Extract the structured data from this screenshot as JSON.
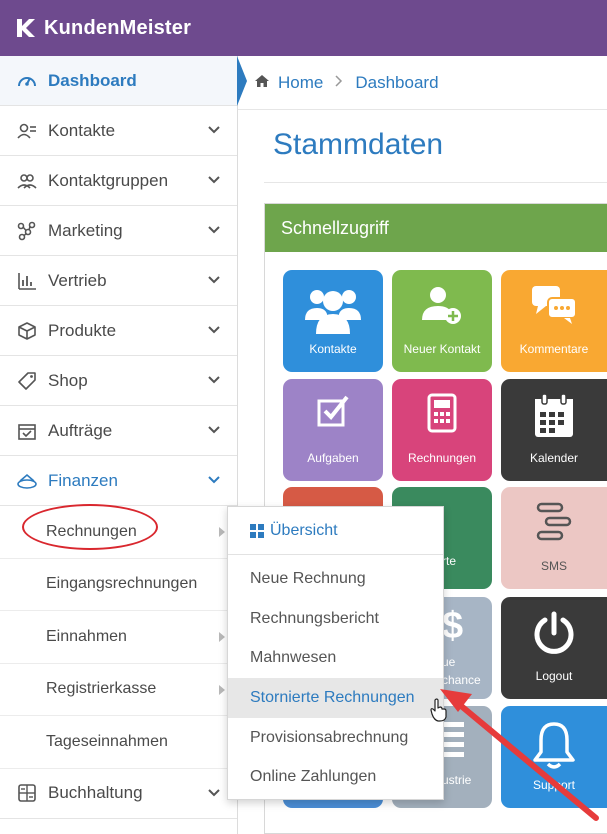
{
  "app": {
    "name": "KundenMeister"
  },
  "sidebar": {
    "items": [
      {
        "label": "Dashboard",
        "icon": "dashboard-icon"
      },
      {
        "label": "Kontakte",
        "icon": "contacts-icon"
      },
      {
        "label": "Kontaktgruppen",
        "icon": "contact-groups-icon"
      },
      {
        "label": "Marketing",
        "icon": "marketing-icon"
      },
      {
        "label": "Vertrieb",
        "icon": "sales-chart-icon"
      },
      {
        "label": "Produkte",
        "icon": "box-icon"
      },
      {
        "label": "Shop",
        "icon": "tag-icon"
      },
      {
        "label": "Aufträge",
        "icon": "orders-icon"
      },
      {
        "label": "Finanzen",
        "icon": "money-icon"
      }
    ],
    "finanzen_sub": [
      {
        "label": "Rechnungen"
      },
      {
        "label": "Eingangsrechnungen"
      },
      {
        "label": "Einnahmen"
      },
      {
        "label": "Registrierkasse"
      },
      {
        "label": "Tageseinnahmen"
      }
    ],
    "bottom": {
      "label": "Buchhaltung",
      "icon": "calculator-icon"
    }
  },
  "breadcrumb": {
    "home": "Home",
    "current": "Dashboard"
  },
  "page": {
    "title": "Stammdaten"
  },
  "panel": {
    "title": "Schnellzugriff"
  },
  "tiles": {
    "kontakte": "Kontakte",
    "neuer_kontakt": "Neuer Kontakt",
    "kommentare": "Kommentare",
    "aufgaben": "Aufgaben",
    "rechnungen": "Rechnungen",
    "kalender": "Kalender",
    "r3c2_partial": "rte",
    "sms": "SMS",
    "r4c2_partial_line1": "ue",
    "r4c2_partial_line2": "chance",
    "logout": "Logout",
    "r5c2_partial": "ustrie",
    "support": "Support"
  },
  "dropdown": {
    "header": "Übersicht",
    "items": [
      "Neue Rechnung",
      "Rechnungsbericht",
      "Mahnwesen",
      "Stornierte Rechnungen",
      "Provisionsabrechnung",
      "Online Zahlungen"
    ],
    "highlighted_index": 3
  },
  "colors": {
    "topbar": "#6e4a8e",
    "accent": "#2d7bbf",
    "panel_header": "#6ea54c",
    "annotation": "#d9272e"
  }
}
